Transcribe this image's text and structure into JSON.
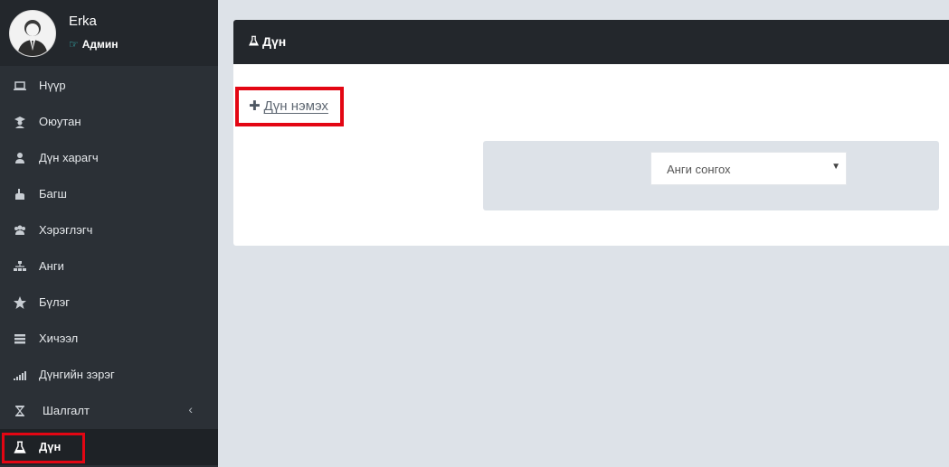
{
  "user": {
    "name": "Erka",
    "role": "Админ"
  },
  "sidebar": {
    "items": [
      {
        "label": "Нүүр",
        "icon": "laptop-icon"
      },
      {
        "label": "Оюутан",
        "icon": "graduate-icon"
      },
      {
        "label": "Дүн харагч",
        "icon": "user-icon"
      },
      {
        "label": "Багш",
        "icon": "teacher-icon"
      },
      {
        "label": "Хэрэглэгч",
        "icon": "users-icon"
      },
      {
        "label": "Анги",
        "icon": "sitemap-icon"
      },
      {
        "label": "Бүлэг",
        "icon": "star-icon"
      },
      {
        "label": "Хичээл",
        "icon": "book-stack-icon"
      },
      {
        "label": "Дүнгийн зэрэг",
        "icon": "signal-icon"
      },
      {
        "label": "Шалгалт",
        "icon": "hourglass-icon"
      },
      {
        "label": "Дүн",
        "icon": "flask-icon",
        "active": true
      }
    ]
  },
  "main": {
    "title": "Дүн",
    "add_label": "Дүн нэмэх",
    "select_value": "Анги сонгох"
  },
  "colors": {
    "sidebar": "#2b3036",
    "header": "#23272c",
    "highlight": "#e30613",
    "background": "#dde2e8"
  }
}
